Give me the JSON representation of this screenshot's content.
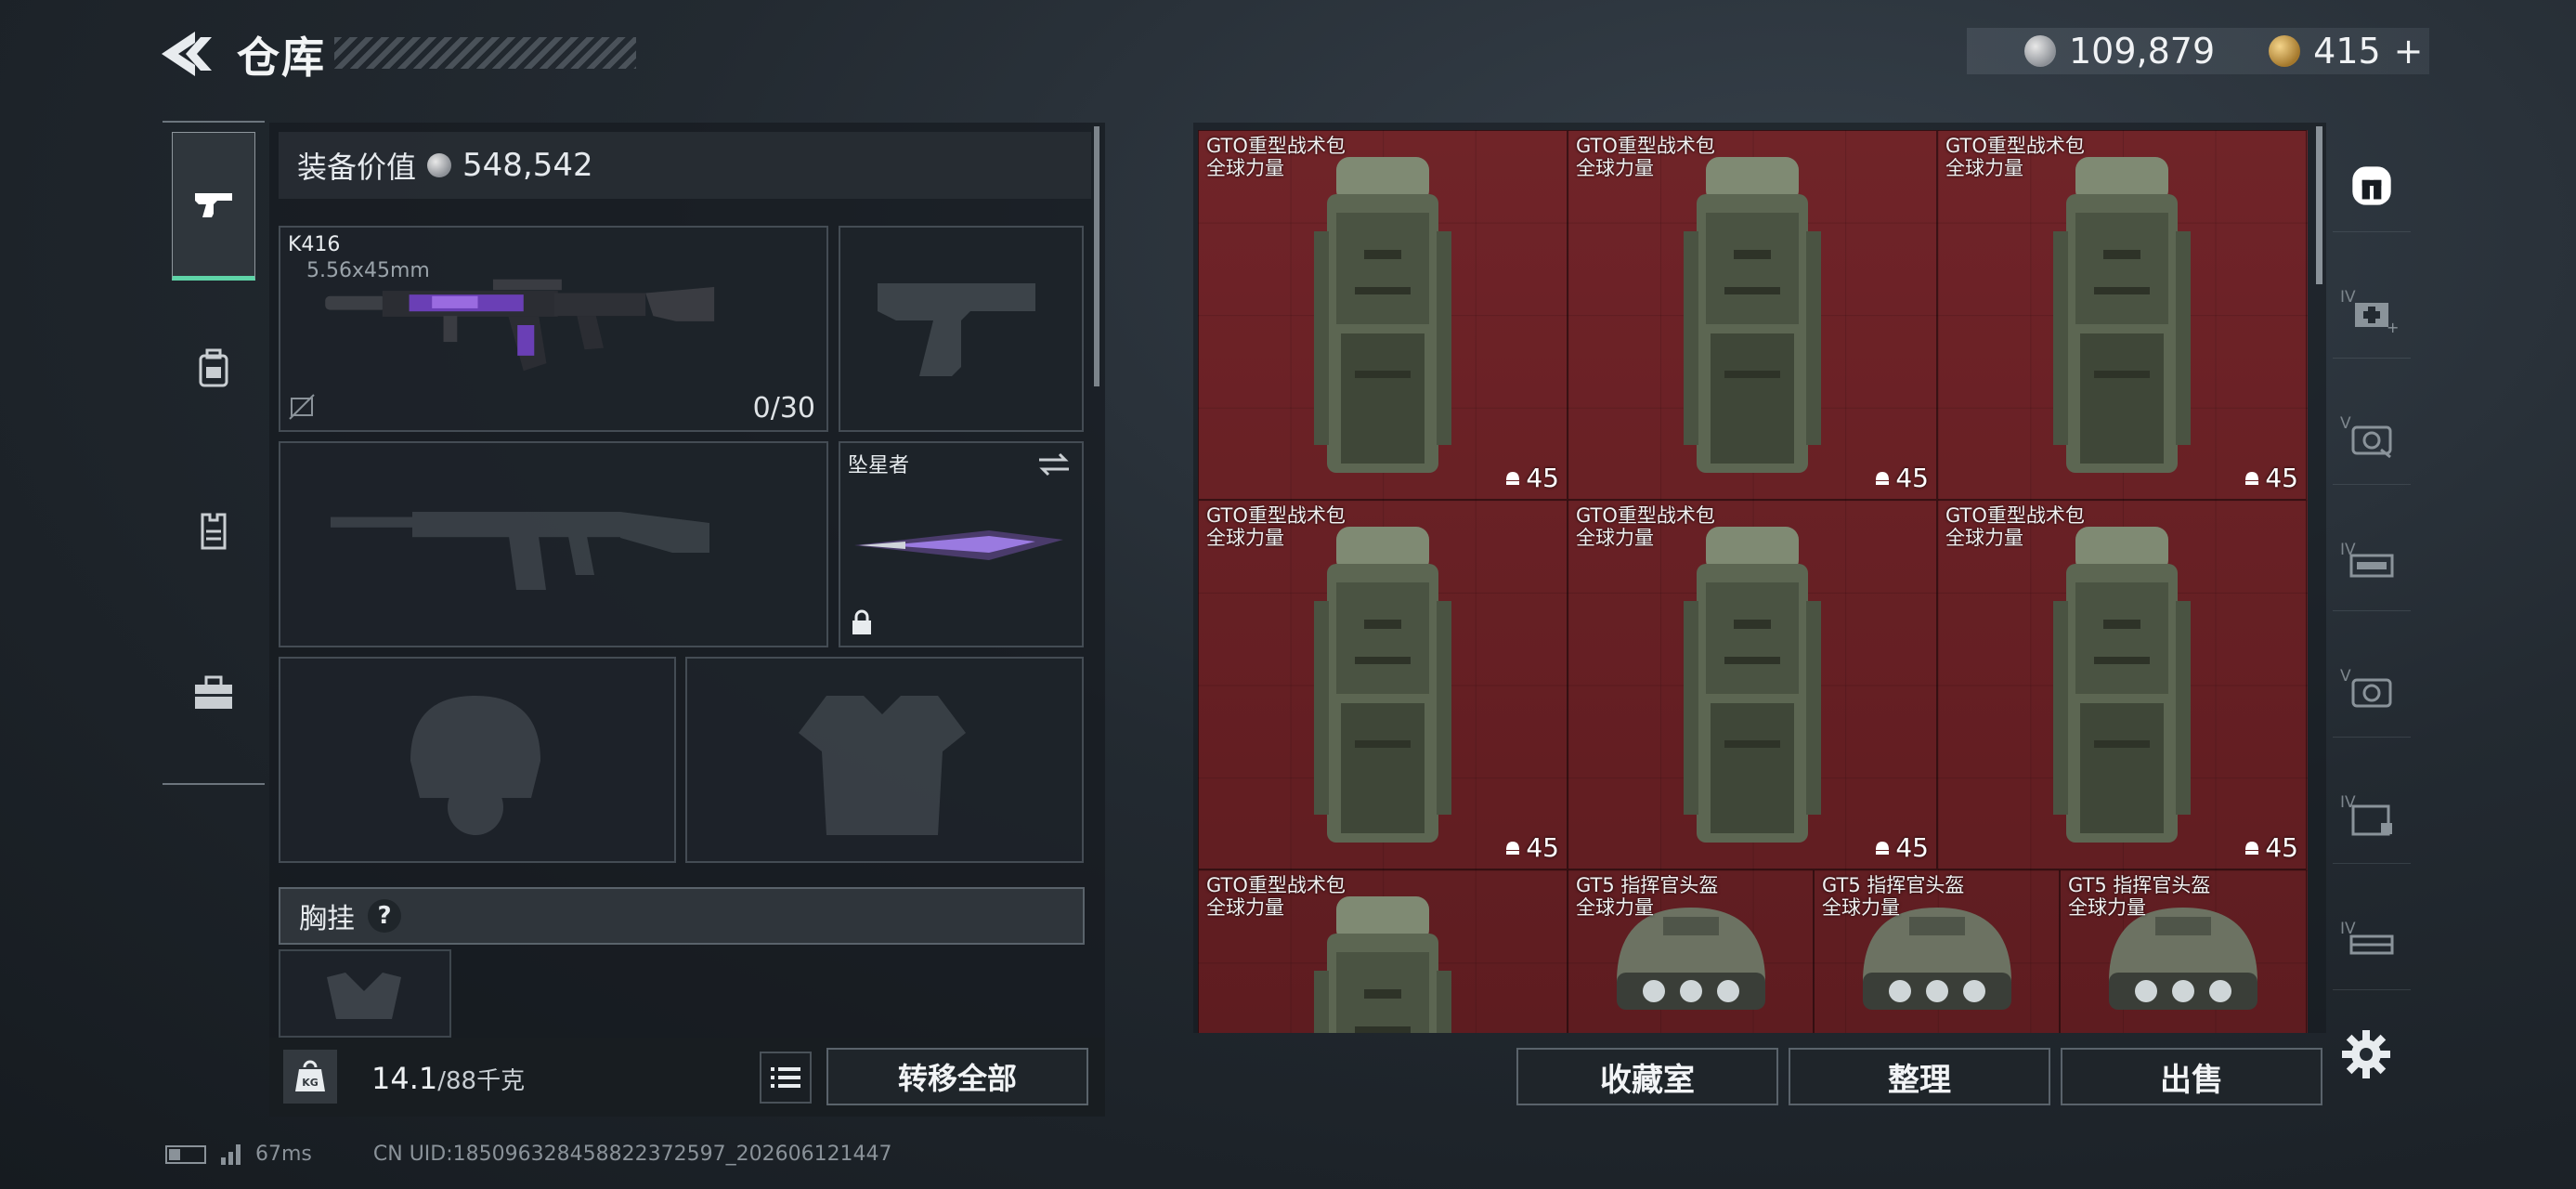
{
  "header": {
    "title": "仓库",
    "currency_silver": "109,879",
    "currency_gold": "415",
    "currency_gold_plus": "+"
  },
  "left_nav": {
    "items": [
      {
        "icon": "pistol-icon",
        "active": true
      },
      {
        "icon": "backpack-icon",
        "active": false
      },
      {
        "icon": "vest-icon",
        "active": false
      },
      {
        "icon": "toolbox-icon",
        "active": false
      }
    ]
  },
  "equipment": {
    "value_label": "装备价值",
    "value": "548,542",
    "primary_name": "K416",
    "primary_caliber": "5.56x45mm",
    "primary_ammo": "0/30",
    "melee_name": "坠星者",
    "chest_label": "胸挂",
    "chest_help": "?",
    "weight_current": "14.1",
    "weight_capacity": "/88千克",
    "kg_label": "KG",
    "transfer_all": "转移全部"
  },
  "storage": {
    "items": [
      {
        "name": "GTO重型战术包",
        "sub": "全球力量",
        "count": "45",
        "kind": "bag"
      },
      {
        "name": "GTO重型战术包",
        "sub": "全球力量",
        "count": "45",
        "kind": "bag"
      },
      {
        "name": "GTO重型战术包",
        "sub": "全球力量",
        "count": "45",
        "kind": "bag"
      },
      {
        "name": "GTO重型战术包",
        "sub": "全球力量",
        "count": "45",
        "kind": "bag"
      },
      {
        "name": "GTO重型战术包",
        "sub": "全球力量",
        "count": "45",
        "kind": "bag"
      },
      {
        "name": "GTO重型战术包",
        "sub": "全球力量",
        "count": "45",
        "kind": "bag"
      },
      {
        "name": "GTO重型战术包",
        "sub": "全球力量",
        "count": "",
        "kind": "bag"
      },
      {
        "name": "GT5 指挥官头盔",
        "sub": "全球力量",
        "count": "",
        "kind": "helmet"
      },
      {
        "name": "GT5 指挥官头盔",
        "sub": "全球力量",
        "count": "",
        "kind": "helmet"
      },
      {
        "name": "GT5 指挥官头盔",
        "sub": "全球力量",
        "count": "",
        "kind": "helmet"
      }
    ],
    "buttons": {
      "collection": "收藏室",
      "organize": "整理",
      "sell": "出售"
    }
  },
  "right_filters": [
    {
      "icon": "all-items-icon",
      "tier": ""
    },
    {
      "icon": "medkit-icon",
      "tier": "IV"
    },
    {
      "icon": "ammo-box-icon",
      "tier": "V"
    },
    {
      "icon": "weapon-case-icon",
      "tier": "IV"
    },
    {
      "icon": "ammo-case-icon",
      "tier": "V"
    },
    {
      "icon": "container-icon",
      "tier": "IV"
    },
    {
      "icon": "crate-icon",
      "tier": "IV"
    }
  ],
  "status": {
    "ping": "67ms",
    "uid": "CN UID:18509632845882237259​7_202606121447"
  }
}
